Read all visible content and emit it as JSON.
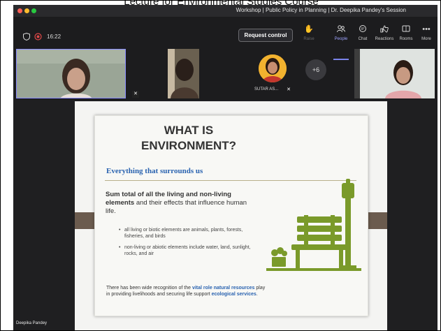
{
  "page_heading_cut": "Lecture for Environmental Studies Course",
  "window": {
    "title": "Workshop | Public Policy in Planning | Dr. Deepika Pandey's Session"
  },
  "colors": {
    "accent": "#7b83eb",
    "slide_accent": "#2a63b0",
    "bench_green": "#7a9a2a",
    "rule": "#b9b08a"
  },
  "toolbar": {
    "timer": "16:22",
    "request_control_label": "Request control",
    "left_icons": [
      "shield-icon",
      "record-icon"
    ],
    "tools": [
      {
        "name": "raise-hand",
        "label": "Raise",
        "icon": "hand-icon",
        "state": "disabled"
      },
      {
        "name": "people",
        "label": "People",
        "icon": "people-icon",
        "state": "active"
      },
      {
        "name": "chat",
        "label": "Chat",
        "icon": "chat-icon",
        "state": "normal"
      },
      {
        "name": "reactions",
        "label": "Reactions",
        "icon": "reactions-icon",
        "state": "normal"
      },
      {
        "name": "rooms",
        "label": "Rooms",
        "icon": "rooms-icon",
        "state": "normal"
      },
      {
        "name": "more",
        "label": "More",
        "icon": "more-icon",
        "state": "normal"
      }
    ]
  },
  "gallery": {
    "participant_name": "SUTAR AS...",
    "overflow_count": "+6"
  },
  "slide": {
    "title_line1": "WHAT IS",
    "title_line2": "ENVIRONMENT?",
    "subtitle": "Everything that surrounds us",
    "body_bold": "Sum total of all the living and non-living elements",
    "body_rest": " and their effects that influence human life.",
    "bullets": [
      "all living or biotic elements are animals, plants, forests, fisheries, and birds",
      "non-living or abiotic elements include water, land, sunlight, rocks, and air"
    ],
    "footer_part1": "There has been wide recognition of the ",
    "footer_hl1": "vital role natural resources",
    "footer_part2": " play in providing livelihoods and securing life support ",
    "footer_hl2": "ecological services",
    "footer_end": "."
  },
  "presenter_name": "Deepika Pandey"
}
